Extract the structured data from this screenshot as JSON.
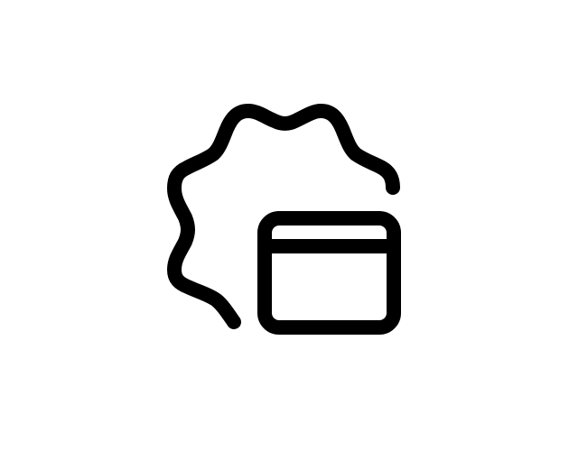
{
  "icon": {
    "name": "badge-window-icon",
    "stroke_color": "#000000",
    "background_color": "#ffffff"
  }
}
